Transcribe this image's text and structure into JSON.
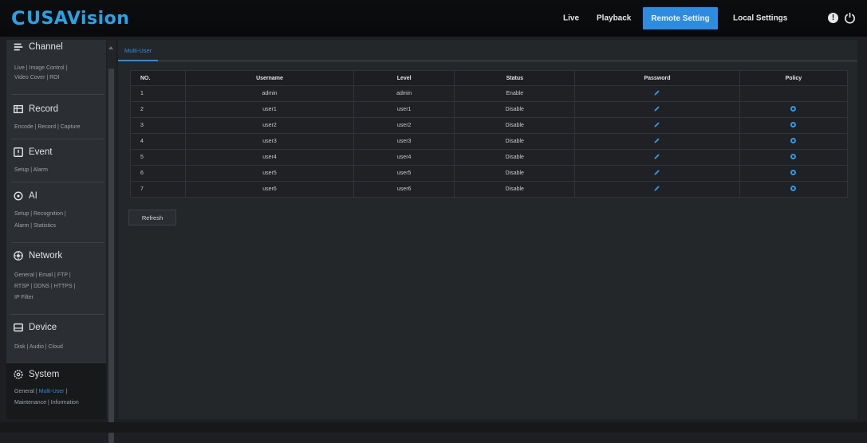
{
  "brand": {
    "logo_text": "USAVision",
    "logo_prefix": "C",
    "accent": "#2d8ce0"
  },
  "nav": {
    "live": "Live",
    "playback": "Playback",
    "remote_setting": "Remote Setting",
    "local_settings": "Local Settings",
    "active": "Remote Setting"
  },
  "header_icons": {
    "help": "help-icon",
    "power": "power-icon"
  },
  "sidebar": {
    "sections": [
      {
        "title": "Channel",
        "icon": "channel-icon",
        "lines": [
          "Live | Image Control |",
          "Video Cover | ROI"
        ]
      },
      {
        "title": "Record",
        "icon": "record-icon",
        "lines": [
          "Encode | Record | Capture"
        ]
      },
      {
        "title": "Event",
        "icon": "event-icon",
        "lines": [
          "Setup | Alarm"
        ]
      },
      {
        "title": "AI",
        "icon": "ai-icon",
        "lines": [
          "Setup | Recognition |",
          "Alarm | Statistics"
        ]
      },
      {
        "title": "Network",
        "icon": "network-icon",
        "lines": [
          "General | Email | FTP |",
          "RTSP | DDNS | HTTPS |",
          "IP Filter"
        ]
      },
      {
        "title": "Device",
        "icon": "device-icon",
        "lines": [
          "Disk | Audio | Cloud"
        ]
      },
      {
        "title": "System",
        "icon": "system-icon",
        "lines_pre": "General | ",
        "active_item": "Multi-User",
        "lines_post": " |",
        "line2": "Maintenance | Information"
      }
    ]
  },
  "main": {
    "tab": "Multi-User",
    "table": {
      "headers": [
        "NO.",
        "Username",
        "Level",
        "Status",
        "Password",
        "Policy"
      ],
      "rows": [
        {
          "no": "1",
          "username": "admin",
          "level": "admin",
          "status": "Enable",
          "password_icon": "edit-icon",
          "policy_icon": ""
        },
        {
          "no": "2",
          "username": "user1",
          "level": "user1",
          "status": "Disable",
          "password_icon": "edit-icon",
          "policy_icon": "gear-icon"
        },
        {
          "no": "3",
          "username": "user2",
          "level": "user2",
          "status": "Disable",
          "password_icon": "edit-icon",
          "policy_icon": "gear-icon"
        },
        {
          "no": "4",
          "username": "user3",
          "level": "user3",
          "status": "Disable",
          "password_icon": "edit-icon",
          "policy_icon": "gear-icon"
        },
        {
          "no": "5",
          "username": "user4",
          "level": "user4",
          "status": "Disable",
          "password_icon": "edit-icon",
          "policy_icon": "gear-icon"
        },
        {
          "no": "6",
          "username": "user5",
          "level": "user5",
          "status": "Disable",
          "password_icon": "edit-icon",
          "policy_icon": "gear-icon"
        },
        {
          "no": "7",
          "username": "user6",
          "level": "user6",
          "status": "Disable",
          "password_icon": "edit-icon",
          "policy_icon": "gear-icon"
        }
      ]
    },
    "refresh_label": "Refresh"
  }
}
